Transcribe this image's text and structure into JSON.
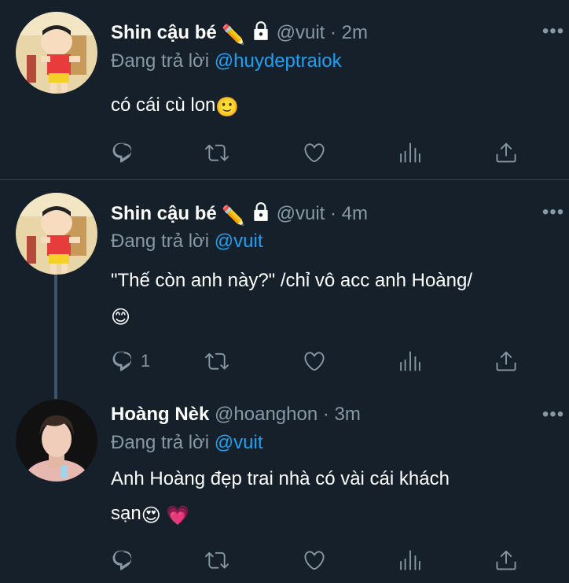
{
  "tweets": [
    {
      "name": "Shin cậu bé",
      "name_emoji": "✏️",
      "handle": "@vuit",
      "time": "2m",
      "reply_prefix": "Đang trả lời",
      "reply_to": "@huydeptraiok",
      "text": "có cái cù lon",
      "text_emoji": "🙂",
      "reply_count": ""
    },
    {
      "name": "Shin cậu bé",
      "name_emoji": "✏️",
      "handle": "@vuit",
      "time": "4m",
      "reply_prefix": "Đang trả lời",
      "reply_to": "@vuit",
      "text": "\"Thế còn anh này?\" /chỉ vô acc anh Hoàng/",
      "text_emoji": "😊",
      "reply_count": "1"
    },
    {
      "name": "Hoàng Nèk",
      "handle": "@hoanghon",
      "time": "3m",
      "reply_prefix": "Đang trả lời",
      "reply_to": "@vuit",
      "text": "Anh Hoàng đẹp trai nhà có vài cái khách",
      "text2": "sạn",
      "text_emoji": "😍",
      "text_emoji2": "💗",
      "reply_count": ""
    }
  ],
  "ui": {
    "separator": "·",
    "more": "•••"
  },
  "colors": {
    "background": "#15202b",
    "muted": "#8899a6",
    "link": "#1da1f2",
    "divider": "#38444d"
  }
}
